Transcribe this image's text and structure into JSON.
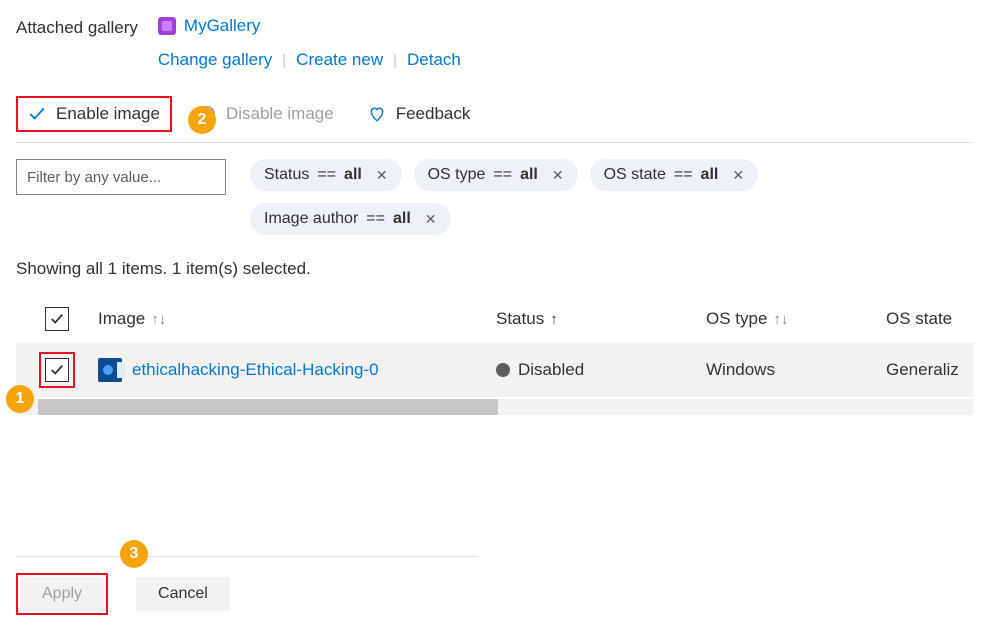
{
  "header": {
    "label": "Attached gallery",
    "gallery_name": "MyGallery",
    "actions": {
      "change": "Change gallery",
      "create": "Create new",
      "detach": "Detach"
    }
  },
  "toolbar": {
    "enable_label": "Enable image",
    "disable_label": "Disable image",
    "feedback_label": "Feedback"
  },
  "callouts": {
    "one": "1",
    "two": "2",
    "three": "3"
  },
  "filters": {
    "input_placeholder": "Filter by any value...",
    "pills": [
      {
        "field": "Status",
        "op": " == ",
        "value": "all"
      },
      {
        "field": "OS type",
        "op": " == ",
        "value": "all"
      },
      {
        "field": "OS state",
        "op": " == ",
        "value": "all"
      },
      {
        "field": "Image author",
        "op": " == ",
        "value": "all"
      }
    ]
  },
  "summary": "Showing all 1 items.   1 item(s) selected.",
  "columns": {
    "image": "Image",
    "status": "Status",
    "ostype": "OS type",
    "osstate": "OS state"
  },
  "rows": [
    {
      "name": "ethicalhacking-Ethical-Hacking-0",
      "status": "Disabled",
      "ostype": "Windows",
      "osstate": "Generaliz"
    }
  ],
  "footer": {
    "apply": "Apply",
    "cancel": "Cancel"
  }
}
